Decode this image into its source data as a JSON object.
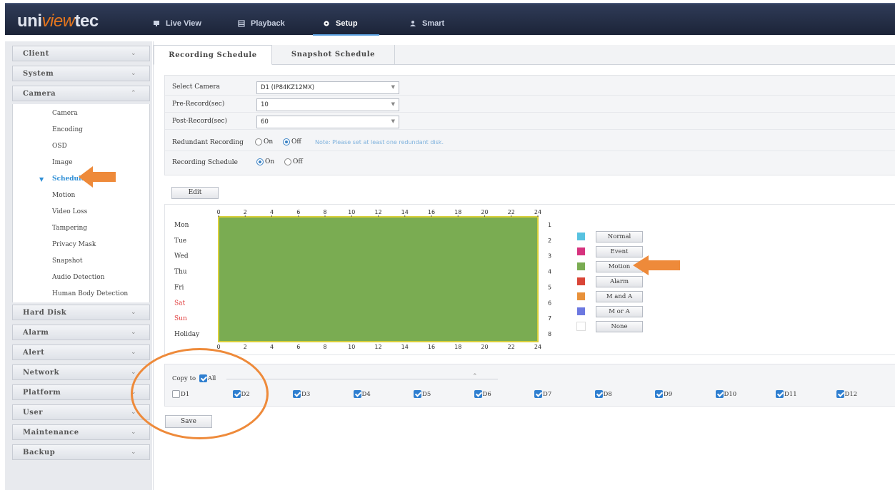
{
  "brand": {
    "part1": "uni",
    "part2": "view",
    "part3": "tec"
  },
  "nav": [
    {
      "label": "Live View",
      "icon": "monitor-icon"
    },
    {
      "label": "Playback",
      "icon": "playback-icon"
    },
    {
      "label": "Setup",
      "icon": "gear-icon"
    },
    {
      "label": "Smart",
      "icon": "person-icon"
    }
  ],
  "sidebar": {
    "categories_top": [
      "Client",
      "System",
      "Camera"
    ],
    "camera_items": [
      "Camera",
      "Encoding",
      "OSD",
      "Image",
      "Schedule",
      "Motion",
      "Video Loss",
      "Tampering",
      "Privacy Mask",
      "Snapshot",
      "Audio Detection",
      "Human Body Detection"
    ],
    "active_item": "Schedule",
    "categories_bottom": [
      "Hard Disk",
      "Alarm",
      "Alert",
      "Network",
      "Platform",
      "User",
      "Maintenance",
      "Backup"
    ]
  },
  "tabs": [
    "Recording Schedule",
    "Snapshot Schedule"
  ],
  "form": {
    "select_camera_label": "Select Camera",
    "select_camera_value": "D1 (IP84KZ12MX)",
    "pre_record_label": "Pre-Record(sec)",
    "pre_record_value": "10",
    "post_record_label": "Post-Record(sec)",
    "post_record_value": "60",
    "redundant_label": "Redundant Recording",
    "redundant_on": "On",
    "redundant_off": "Off",
    "redundant_selected": "Off",
    "redundant_note": "Note: Please set at least one redundant disk.",
    "schedule_label": "Recording Schedule",
    "schedule_on": "On",
    "schedule_off": "Off",
    "schedule_selected": "On"
  },
  "edit_label": "Edit",
  "schedule": {
    "hours": [
      "0",
      "2",
      "4",
      "6",
      "8",
      "10",
      "12",
      "14",
      "16",
      "18",
      "20",
      "22",
      "24"
    ],
    "days": [
      "Mon",
      "Tue",
      "Wed",
      "Thu",
      "Fri",
      "Sat",
      "Sun",
      "Holiday"
    ],
    "weekend_days": [
      "Sat",
      "Sun"
    ],
    "row_numbers": [
      "1",
      "2",
      "3",
      "4",
      "5",
      "6",
      "7",
      "8"
    ],
    "fill_type": "Motion",
    "fill_color": "#7aac52"
  },
  "legend": [
    {
      "label": "Normal",
      "color": "#58c2e0"
    },
    {
      "label": "Event",
      "color": "#d6337e"
    },
    {
      "label": "Motion",
      "color": "#7aac52"
    },
    {
      "label": "Alarm",
      "color": "#d94537"
    },
    {
      "label": "M and A",
      "color": "#e8913a"
    },
    {
      "label": "M or A",
      "color": "#6c78e0"
    },
    {
      "label": "None",
      "color": "#ffffff"
    }
  ],
  "copy": {
    "copy_to_label": "Copy to",
    "all_label": "All",
    "channels": [
      {
        "label": "D1",
        "checked": false
      },
      {
        "label": "D2",
        "checked": true
      },
      {
        "label": "D3",
        "checked": true
      },
      {
        "label": "D4",
        "checked": true
      },
      {
        "label": "D5",
        "checked": true
      },
      {
        "label": "D6",
        "checked": true
      },
      {
        "label": "D7",
        "checked": true
      },
      {
        "label": "D8",
        "checked": true
      },
      {
        "label": "D9",
        "checked": true
      },
      {
        "label": "D10",
        "checked": true
      },
      {
        "label": "D11",
        "checked": true
      },
      {
        "label": "D12",
        "checked": true
      }
    ]
  },
  "save_label": "Save",
  "colors": {
    "accent": "#2f8fd6",
    "annotation": "#ee8a3a",
    "topbar": "#1c2438"
  }
}
